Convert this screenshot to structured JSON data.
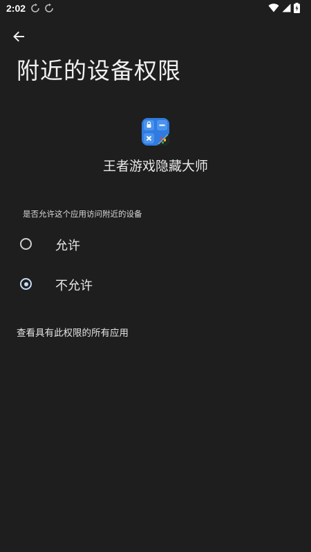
{
  "status_bar": {
    "time": "2:02",
    "icons": [
      "sync-icon",
      "sync-icon",
      "wifi-icon",
      "signal-icon",
      "battery-charging-icon"
    ]
  },
  "toolbar": {
    "back_icon": "arrow-back-icon"
  },
  "page": {
    "title": "附近的设备权限"
  },
  "app": {
    "name": "王者游戏隐藏大师",
    "icon": "calculator-app-icon",
    "icon_color": "#2f7be0"
  },
  "permission": {
    "question": "是否允许这个应用访问附近的设备",
    "options": [
      {
        "label": "允许",
        "selected": false
      },
      {
        "label": "不允许",
        "selected": true
      }
    ],
    "see_all_link": "查看具有此权限的所有应用"
  },
  "colors": {
    "background": "#1e1e1e",
    "accent": "#c4dcf5"
  }
}
